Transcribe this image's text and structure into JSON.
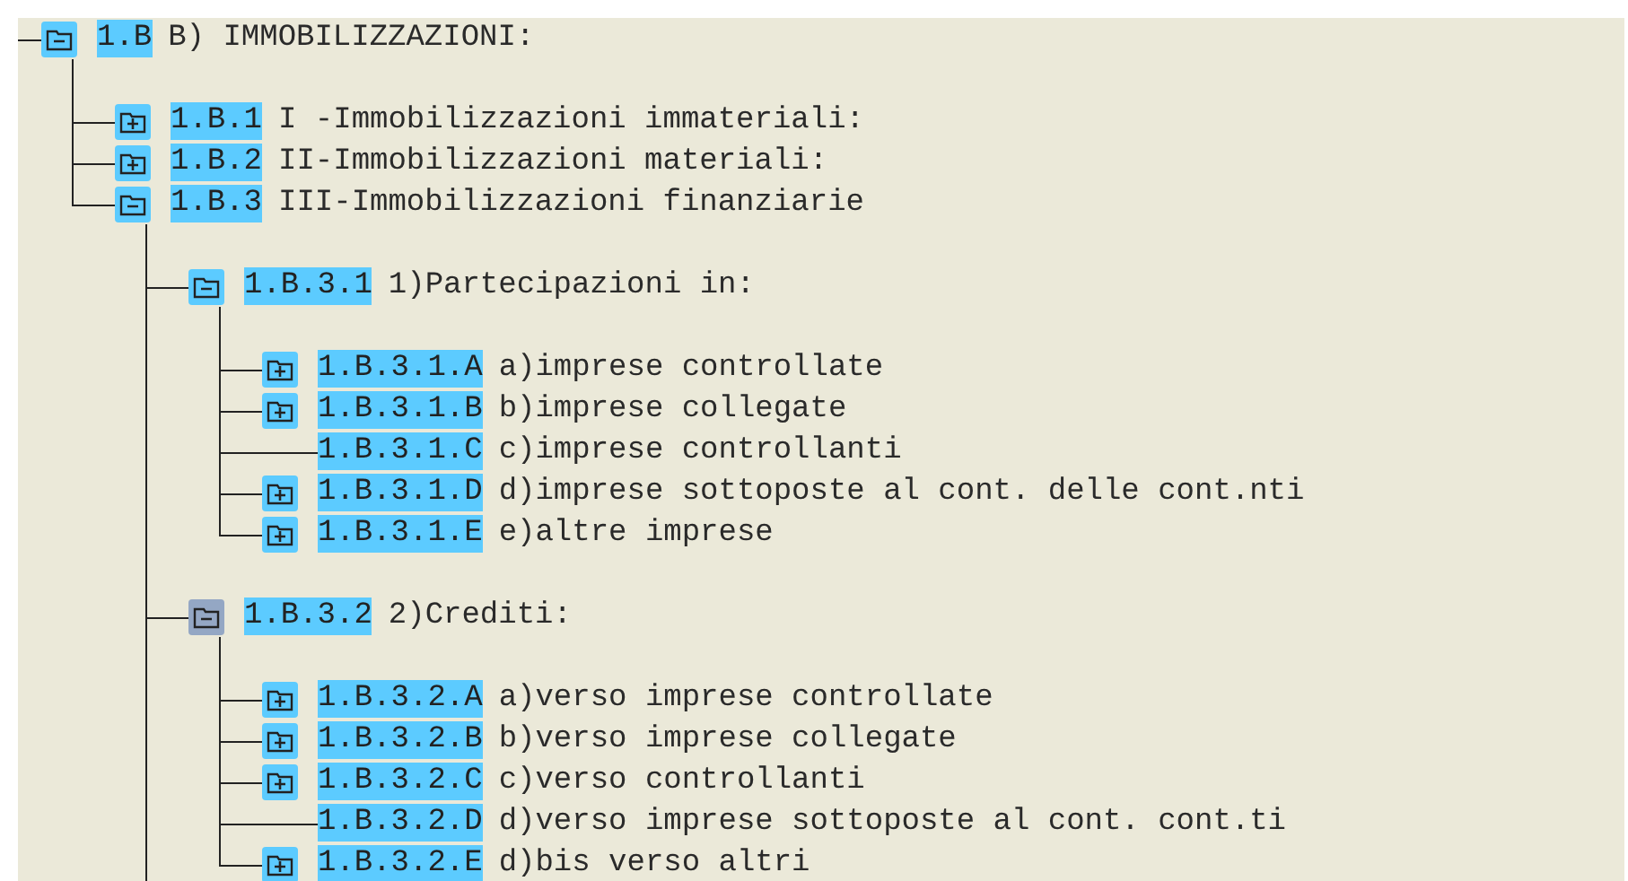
{
  "tree": {
    "code": "1.B",
    "text": "B) IMMOBILIZZAZIONI:",
    "kind": "folder",
    "expanded": true,
    "focused": false,
    "children": [
      {
        "code": "1.B.1",
        "text": "I -Immobilizzazioni immateriali:",
        "kind": "folder",
        "expanded": false,
        "focused": false
      },
      {
        "code": "1.B.2",
        "text": "II-Immobilizzazioni materiali:",
        "kind": "folder",
        "expanded": false,
        "focused": false
      },
      {
        "code": "1.B.3",
        "text": "III-Immobilizzazioni finanziarie",
        "kind": "folder",
        "expanded": true,
        "focused": false,
        "more_below": true,
        "children": [
          {
            "code": "1.B.3.1",
            "text": "1)Partecipazioni in:",
            "kind": "folder",
            "expanded": true,
            "focused": false,
            "children": [
              {
                "code": "1.B.3.1.A",
                "text": "a)imprese controllate",
                "kind": "folder",
                "expanded": false,
                "focused": false
              },
              {
                "code": "1.B.3.1.B",
                "text": "b)imprese collegate",
                "kind": "folder",
                "expanded": false,
                "focused": false
              },
              {
                "code": "1.B.3.1.C",
                "text": "c)imprese controllanti",
                "kind": "leaf"
              },
              {
                "code": "1.B.3.1.D",
                "text": "d)imprese sottoposte al cont. delle cont.nti",
                "kind": "folder",
                "expanded": false,
                "focused": false
              },
              {
                "code": "1.B.3.1.E",
                "text": "e)altre imprese",
                "kind": "folder",
                "expanded": false,
                "focused": false
              }
            ]
          },
          {
            "code": "1.B.3.2",
            "text": "2)Crediti:",
            "kind": "folder",
            "expanded": true,
            "focused": true,
            "children": [
              {
                "code": "1.B.3.2.A",
                "text": "a)verso imprese controllate",
                "kind": "folder",
                "expanded": false,
                "focused": false
              },
              {
                "code": "1.B.3.2.B",
                "text": "b)verso imprese collegate",
                "kind": "folder",
                "expanded": false,
                "focused": false
              },
              {
                "code": "1.B.3.2.C",
                "text": "c)verso controllanti",
                "kind": "folder",
                "expanded": false,
                "focused": false
              },
              {
                "code": "1.B.3.2.D",
                "text": "d)verso imprese sottoposte al cont. cont.ti",
                "kind": "leaf"
              },
              {
                "code": "1.B.3.2.E",
                "text": "d)bis verso altri",
                "kind": "folder",
                "expanded": false,
                "focused": false
              }
            ]
          }
        ]
      }
    ]
  }
}
